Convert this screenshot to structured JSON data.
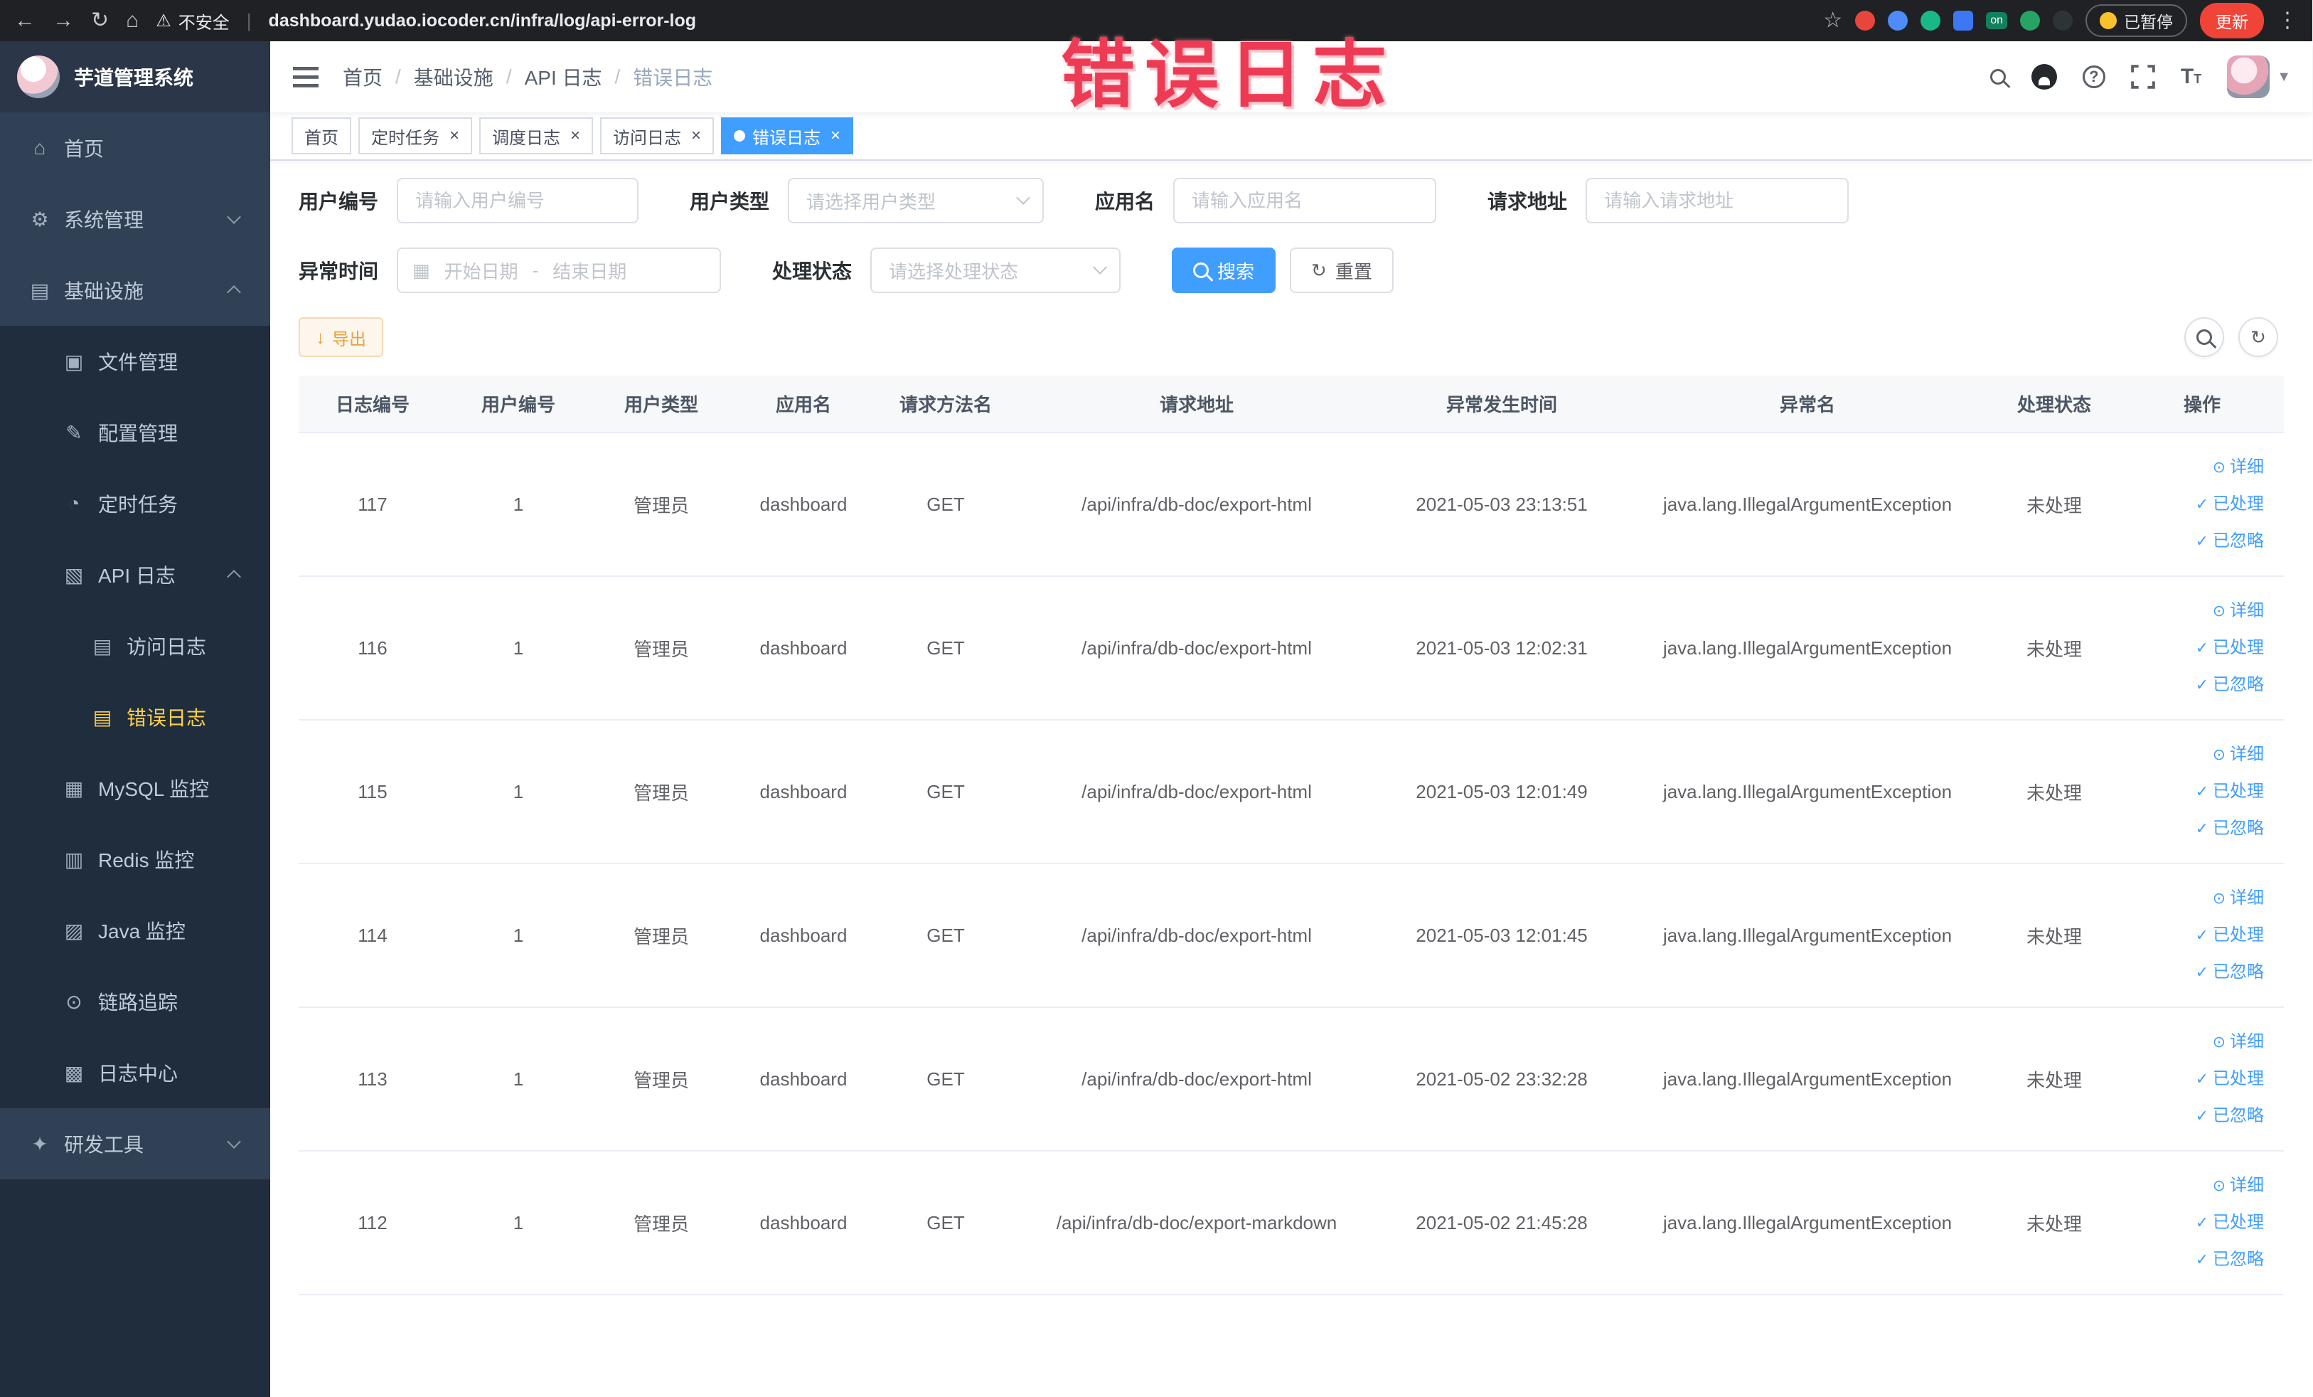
{
  "annotation": {
    "text": "错误日志"
  },
  "browser": {
    "security_label": "不安全",
    "url": "dashboard.yudao.iocoder.cn/infra/log/api-error-log",
    "extension_on_label": "on",
    "paused_label": "已暂停",
    "update_label": "更新"
  },
  "sidebar": {
    "logo_title": "芋道管理系统",
    "menu": [
      {
        "id": "home",
        "label": "首页",
        "icon": "home-icon",
        "level": 1
      },
      {
        "id": "system-management",
        "label": "系统管理",
        "icon": "gear-icon",
        "level": 1,
        "arrow": "down"
      },
      {
        "id": "infrastructure",
        "label": "基础设施",
        "icon": "infra-icon",
        "level": 1,
        "arrow": "up"
      },
      {
        "id": "file-management",
        "label": "文件管理",
        "icon": "folder-icon",
        "level": 2
      },
      {
        "id": "config-management",
        "label": "配置管理",
        "icon": "edit-icon",
        "level": 2
      },
      {
        "id": "scheduled-tasks",
        "label": "定时任务",
        "icon": "timer-icon",
        "level": 2
      },
      {
        "id": "api-log",
        "label": "API 日志",
        "icon": "api-log-icon",
        "level": 2,
        "arrow": "up"
      },
      {
        "id": "access-log",
        "label": "访问日志",
        "icon": "doc-icon",
        "level": 3
      },
      {
        "id": "error-log",
        "label": "错误日志",
        "icon": "doc-icon",
        "level": 3,
        "active": true
      },
      {
        "id": "mysql-monitor",
        "label": "MySQL 监控",
        "icon": "mysql-icon",
        "level": 2
      },
      {
        "id": "redis-monitor",
        "label": "Redis 监控",
        "icon": "redis-icon",
        "level": 2
      },
      {
        "id": "java-monitor",
        "label": "Java 监控",
        "icon": "java-icon",
        "level": 2
      },
      {
        "id": "trace",
        "label": "链路追踪",
        "icon": "trace-icon",
        "level": 2
      },
      {
        "id": "log-center",
        "label": "日志中心",
        "icon": "log-center-icon",
        "level": 2
      },
      {
        "id": "dev-tools",
        "label": "研发工具",
        "icon": "tool-icon",
        "level": 1,
        "arrow": "down"
      }
    ]
  },
  "header": {
    "breadcrumb": [
      "首页",
      "基础设施",
      "API 日志",
      "错误日志"
    ],
    "breadcrumb_separator": "/"
  },
  "tabs": [
    {
      "label": "首页",
      "closable": false,
      "active": false
    },
    {
      "label": "定时任务",
      "closable": true,
      "active": false
    },
    {
      "label": "调度日志",
      "closable": true,
      "active": false
    },
    {
      "label": "访问日志",
      "closable": true,
      "active": false
    },
    {
      "label": "错误日志",
      "closable": true,
      "active": true
    }
  ],
  "filters": {
    "user_id": {
      "label": "用户编号",
      "placeholder": "请输入用户编号"
    },
    "user_type": {
      "label": "用户类型",
      "placeholder": "请选择用户类型"
    },
    "app_name": {
      "label": "应用名",
      "placeholder": "请输入应用名"
    },
    "request_url": {
      "label": "请求地址",
      "placeholder": "请输入请求地址"
    },
    "exception_time": {
      "label": "异常时间",
      "start_placeholder": "开始日期",
      "separator": "-",
      "end_placeholder": "结束日期"
    },
    "process_status": {
      "label": "处理状态",
      "placeholder": "请选择处理状态"
    },
    "search_label": "搜索",
    "reset_label": "重置"
  },
  "toolbar": {
    "export_label": "导出"
  },
  "table": {
    "columns": [
      "日志编号",
      "用户编号",
      "用户类型",
      "应用名",
      "请求方法名",
      "请求地址",
      "异常发生时间",
      "异常名",
      "处理状态",
      "操作"
    ],
    "actions": [
      {
        "id": "detail",
        "label": "详细",
        "icon": "eye-icon"
      },
      {
        "id": "processed",
        "label": "已处理",
        "icon": "check-icon"
      },
      {
        "id": "ignored",
        "label": "已忽略",
        "icon": "check-icon"
      }
    ],
    "rows": [
      {
        "id": "117",
        "user_id": "1",
        "user_type": "管理员",
        "app": "dashboard",
        "method": "GET",
        "url": "/api/infra/db-doc/export-html",
        "time": "2021-05-03 23:13:51",
        "exception": "java.lang.IllegalArgumentException",
        "status": "未处理"
      },
      {
        "id": "116",
        "user_id": "1",
        "user_type": "管理员",
        "app": "dashboard",
        "method": "GET",
        "url": "/api/infra/db-doc/export-html",
        "time": "2021-05-03 12:02:31",
        "exception": "java.lang.IllegalArgumentException",
        "status": "未处理"
      },
      {
        "id": "115",
        "user_id": "1",
        "user_type": "管理员",
        "app": "dashboard",
        "method": "GET",
        "url": "/api/infra/db-doc/export-html",
        "time": "2021-05-03 12:01:49",
        "exception": "java.lang.IllegalArgumentException",
        "status": "未处理"
      },
      {
        "id": "114",
        "user_id": "1",
        "user_type": "管理员",
        "app": "dashboard",
        "method": "GET",
        "url": "/api/infra/db-doc/export-html",
        "time": "2021-05-03 12:01:45",
        "exception": "java.lang.IllegalArgumentException",
        "status": "未处理"
      },
      {
        "id": "113",
        "user_id": "1",
        "user_type": "管理员",
        "app": "dashboard",
        "method": "GET",
        "url": "/api/infra/db-doc/export-html",
        "time": "2021-05-02 23:32:28",
        "exception": "java.lang.IllegalArgumentException",
        "status": "未处理"
      },
      {
        "id": "112",
        "user_id": "1",
        "user_type": "管理员",
        "app": "dashboard",
        "method": "GET",
        "url": "/api/infra/db-doc/export-markdown",
        "time": "2021-05-02 21:45:28",
        "exception": "java.lang.IllegalArgumentException",
        "status": "未处理"
      }
    ]
  },
  "colors": {
    "accent": "#409eff",
    "sidebar_bg": "#304156",
    "submenu_bg": "#1f2d3d",
    "active_menu_text": "#ffd04b",
    "warning": "#e6a23c",
    "annotation_red": "#ee3b55"
  }
}
